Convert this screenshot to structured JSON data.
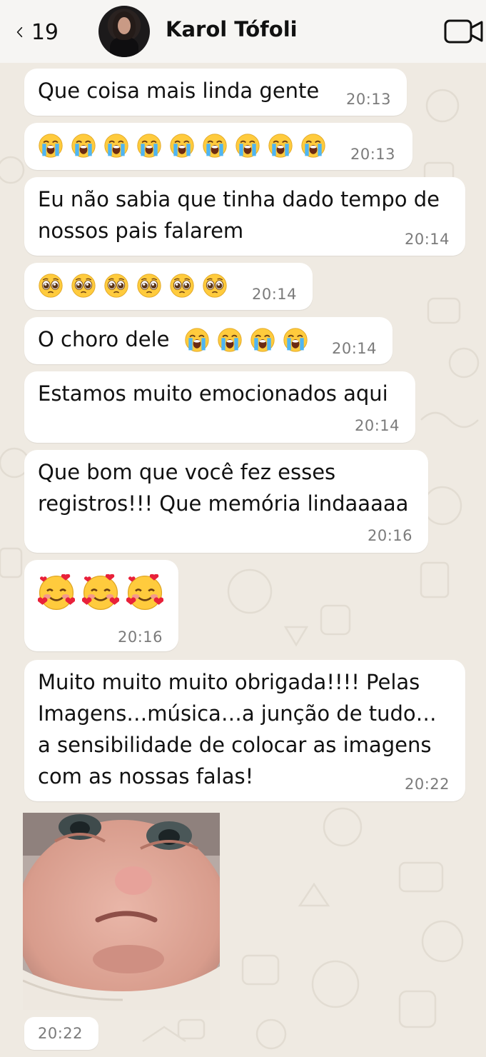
{
  "header": {
    "unread_count": "19",
    "contact_name": "Karol Tófoli"
  },
  "messages": [
    {
      "text": "Que coisa mais linda gente",
      "time": "20:13"
    },
    {
      "emoji": "loudly-crying-face",
      "count": 9,
      "time": "20:13"
    },
    {
      "lines": [
        "Eu não sabia que tinha dado tempo de",
        "nossos pais falarem"
      ],
      "time": "20:14"
    },
    {
      "emoji": "pleading-face",
      "count": 6,
      "time": "20:14"
    },
    {
      "text": "O choro dele",
      "emoji": "loudly-crying-face",
      "count": 4,
      "time": "20:14"
    },
    {
      "text": "Estamos muito emocionados aqui",
      "time": "20:14"
    },
    {
      "lines": [
        "Que bom que você fez esses",
        "registros!!! Que memória lindaaaaa"
      ],
      "time": "20:16"
    },
    {
      "emoji": "smiling-face-with-hearts",
      "count": 3,
      "time": "20:16"
    },
    {
      "lines": [
        "Muito muito muito obrigada!!!! Pelas",
        "Imagens…música…a junção de tudo…",
        "a sensibilidade de colocar as imagens",
        "com as nossas falas!"
      ],
      "time": "20:22"
    },
    {
      "image": "crying-baby-sticker",
      "time": "20:22"
    }
  ],
  "colors": {
    "chat_background": "#efeae2",
    "bubble": "#ffffff",
    "header": "#f6f5f3",
    "timestamp": "#7b7b7b"
  }
}
